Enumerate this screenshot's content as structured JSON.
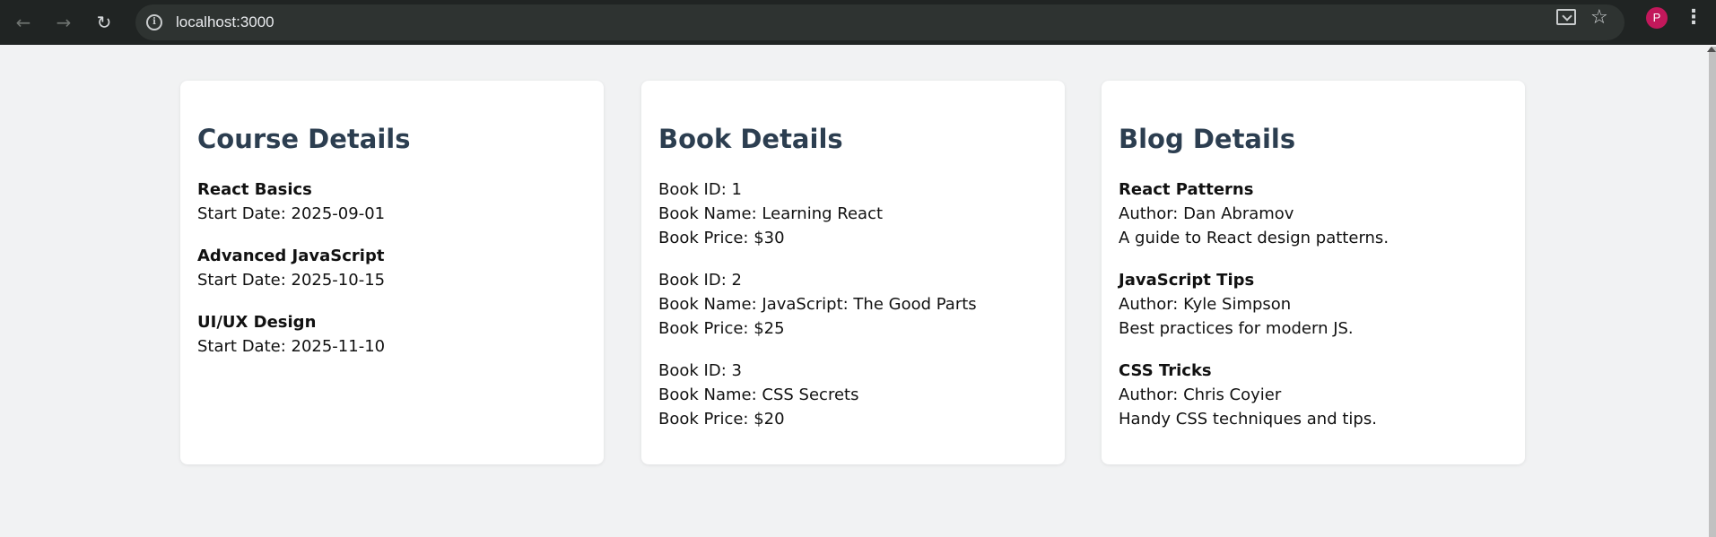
{
  "browser": {
    "url": "localhost:3000",
    "avatar_letter": "P",
    "icons": {
      "back": "back-arrow-icon",
      "forward": "forward-arrow-icon",
      "reload": "reload-icon",
      "info": "info-icon",
      "install": "install-app-icon",
      "bookmark": "star-icon",
      "menu": "kebab-menu-icon"
    }
  },
  "courses": {
    "heading": "Course Details",
    "items": [
      {
        "name": "React Basics",
        "date": "Start Date: 2025-09-01"
      },
      {
        "name": "Advanced JavaScript",
        "date": "Start Date: 2025-10-15"
      },
      {
        "name": "UI/UX Design",
        "date": "Start Date: 2025-11-10"
      }
    ]
  },
  "books": {
    "heading": "Book Details",
    "items": [
      {
        "id": "Book ID: 1",
        "name": "Book Name: Learning React",
        "price": "Book Price: $30"
      },
      {
        "id": "Book ID: 2",
        "name": "Book Name: JavaScript: The Good Parts",
        "price": "Book Price: $25"
      },
      {
        "id": "Book ID: 3",
        "name": "Book Name: CSS Secrets",
        "price": "Book Price: $20"
      }
    ]
  },
  "blogs": {
    "heading": "Blog Details",
    "items": [
      {
        "title": "React Patterns",
        "author": "Author: Dan Abramov",
        "desc": "A guide to React design patterns."
      },
      {
        "title": "JavaScript Tips",
        "author": "Author: Kyle Simpson",
        "desc": "Best practices for modern JS."
      },
      {
        "title": "CSS Tricks",
        "author": "Author: Chris Coyier",
        "desc": "Handy CSS techniques and tips."
      }
    ]
  },
  "colors": {
    "heading": "#2c3e50",
    "page_background": "#f1f2f3",
    "toolbar": "#202423",
    "avatar": "#c2185b"
  }
}
